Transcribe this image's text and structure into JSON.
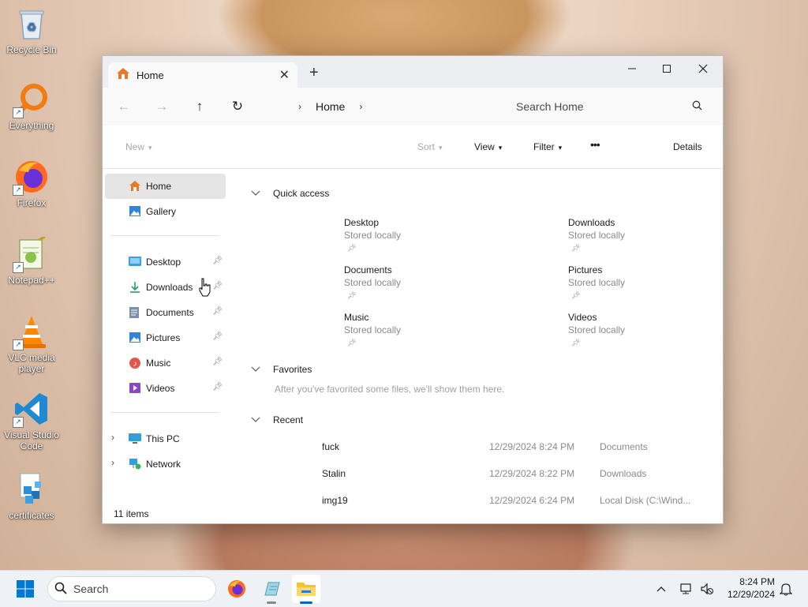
{
  "desktop": {
    "icons": [
      {
        "label": "Recycle Bin",
        "icon": "recycle-bin-icon"
      },
      {
        "label": "Everything",
        "icon": "everything-search-icon"
      },
      {
        "label": "Firefox",
        "icon": "firefox-icon"
      },
      {
        "label": "Notepad++",
        "icon": "notepad-plus-plus-icon"
      },
      {
        "label": "VLC media player",
        "icon": "vlc-cone-icon"
      },
      {
        "label": "Visual Studio Code",
        "icon": "vscode-icon"
      },
      {
        "label": "certificates",
        "icon": "certificates-icon"
      }
    ]
  },
  "window": {
    "tab_title": "Home",
    "nav": {
      "breadcrumb_item": "Home",
      "search_placeholder": "Search Home"
    },
    "commands": {
      "new": "New",
      "sort": "Sort",
      "view": "View",
      "filter": "Filter",
      "more": "•••",
      "details": "Details"
    },
    "sidebar": {
      "top": [
        {
          "label": "Home",
          "icon": "home-icon",
          "selected": true
        },
        {
          "label": "Gallery",
          "icon": "gallery-icon"
        }
      ],
      "pinned": [
        {
          "label": "Desktop",
          "icon": "desktop-folder-icon"
        },
        {
          "label": "Downloads",
          "icon": "downloads-folder-icon"
        },
        {
          "label": "Documents",
          "icon": "documents-folder-icon"
        },
        {
          "label": "Pictures",
          "icon": "pictures-folder-icon"
        },
        {
          "label": "Music",
          "icon": "music-folder-icon"
        },
        {
          "label": "Videos",
          "icon": "videos-folder-icon"
        }
      ],
      "locations": [
        {
          "label": "This PC",
          "icon": "this-pc-icon"
        },
        {
          "label": "Network",
          "icon": "network-icon"
        }
      ]
    },
    "status": "11 items",
    "quick_access": {
      "heading": "Quick access",
      "items": [
        {
          "name": "Desktop",
          "sub": "Stored locally"
        },
        {
          "name": "Downloads",
          "sub": "Stored locally"
        },
        {
          "name": "Documents",
          "sub": "Stored locally"
        },
        {
          "name": "Pictures",
          "sub": "Stored locally"
        },
        {
          "name": "Music",
          "sub": "Stored locally"
        },
        {
          "name": "Videos",
          "sub": "Stored locally"
        }
      ]
    },
    "favorites": {
      "heading": "Favorites",
      "hint": "After you've favorited some files, we'll show them here."
    },
    "recent": {
      "heading": "Recent",
      "rows": [
        {
          "name": "fuck",
          "date": "12/29/2024 8:24 PM",
          "location": "Documents"
        },
        {
          "name": "Stalin",
          "date": "12/29/2024 8:22 PM",
          "location": "Downloads"
        },
        {
          "name": "img19",
          "date": "12/29/2024 6:24 PM",
          "location": "Local Disk (C:\\Wind..."
        }
      ]
    }
  },
  "taskbar": {
    "search_label": "Search",
    "clock_time": "8:24 PM",
    "clock_date": "12/29/2024"
  },
  "colors": {
    "accent": "#0067c0",
    "home_icon": "#e8792b"
  }
}
